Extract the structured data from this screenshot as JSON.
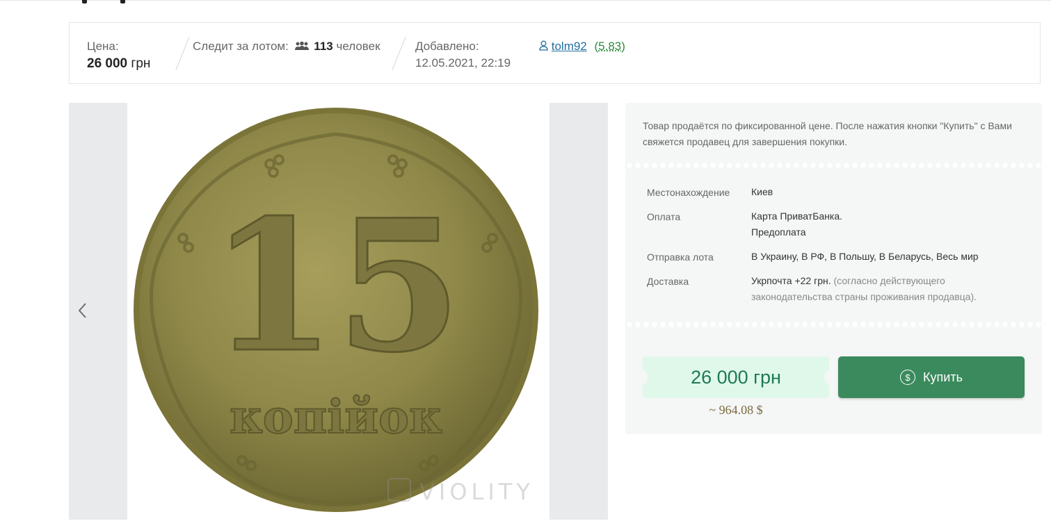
{
  "info": {
    "price_label": "Цена:",
    "price_value": "26 000",
    "price_currency": "грн",
    "watch_label": "Следит за лотом:",
    "watch_count": "113",
    "watch_unit": "человек",
    "added_label": "Добавлено:",
    "added_date": "12.05.2021, 22:19",
    "seller_name": "tolm92",
    "seller_rating_open": "(",
    "seller_rating": "5.83",
    "seller_rating_close": ")"
  },
  "gallery": {
    "coin_number": "15",
    "coin_word": "копійок",
    "watermark": "VIOLITY"
  },
  "panel": {
    "notice": "Товар продаётся по фиксированной цене. После нажатия кнопки \"Купить\" с Вами свяжется продавец для завершения покупки.",
    "location_label": "Местонахождение",
    "location_value": "Киев",
    "payment_label": "Оплата",
    "payment_line1": "Карта ПриватБанка.",
    "payment_line2": "Предоплата",
    "shipping_label": "Отправка лота",
    "shipping_value": "В Украину, В РФ, В Польшу, В Беларусь, Весь мир",
    "delivery_label": "Доставка",
    "delivery_value": "Укрпочта +22 грн.",
    "delivery_note_line1": "(согласно действующего",
    "delivery_note_line2": "законодательства страны проживания продавца)."
  },
  "purchase": {
    "price": "26 000 грн",
    "price_usd": "~ 964.08 $",
    "buy_label": "Купить"
  },
  "colors": {
    "accent_green": "#3b8a5e",
    "price_bg": "#e0f8ea",
    "price_text": "#1e7a52"
  },
  "icons": {
    "watchers": "users-icon",
    "seller": "user-icon",
    "buy": "dollar-circle-icon",
    "gallery_prev": "chevron-left-icon"
  }
}
